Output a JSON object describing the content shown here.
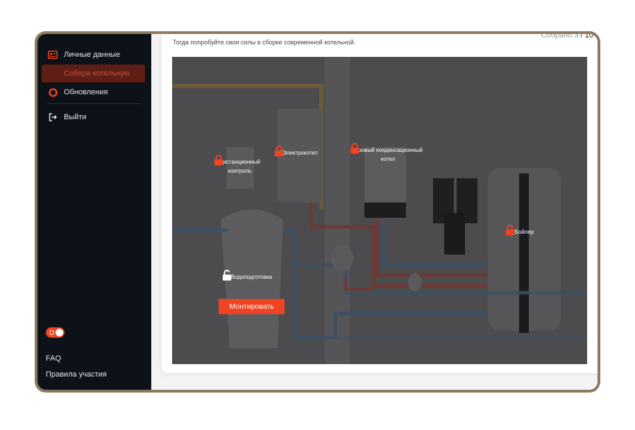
{
  "sidebar": {
    "items": [
      {
        "label": "Личные данные",
        "icon": "id-card-icon"
      },
      {
        "label": "Собери котельную",
        "icon": "boiler-icon",
        "active": true
      },
      {
        "label": "Обновления",
        "icon": "lifebuoy-icon"
      }
    ],
    "logout_label": "Выйти",
    "faq_label": "FAQ",
    "rules_label": "Правила участия"
  },
  "main": {
    "subtitle": "Тогда попробуйте свои силы в сборке современной котельной.",
    "counter": {
      "label": "Собрано",
      "current": "3",
      "separator": "/",
      "total": "10"
    }
  },
  "scene": {
    "hotspots": [
      {
        "label": "Дистанционный контроль",
        "locked": true
      },
      {
        "label": "Электрокотел",
        "locked": true
      },
      {
        "label": "Газовый конденсационный котел",
        "locked": true
      },
      {
        "label": "Бойлер",
        "locked": true
      },
      {
        "label": "Водоподготовка",
        "locked": false
      }
    ],
    "mount_button": "Монтировать"
  },
  "colors": {
    "accent": "#f04323",
    "sidebar_bg": "#0d1118",
    "frame": "#8c7a5e",
    "counter_current": "#2bb3c8"
  }
}
